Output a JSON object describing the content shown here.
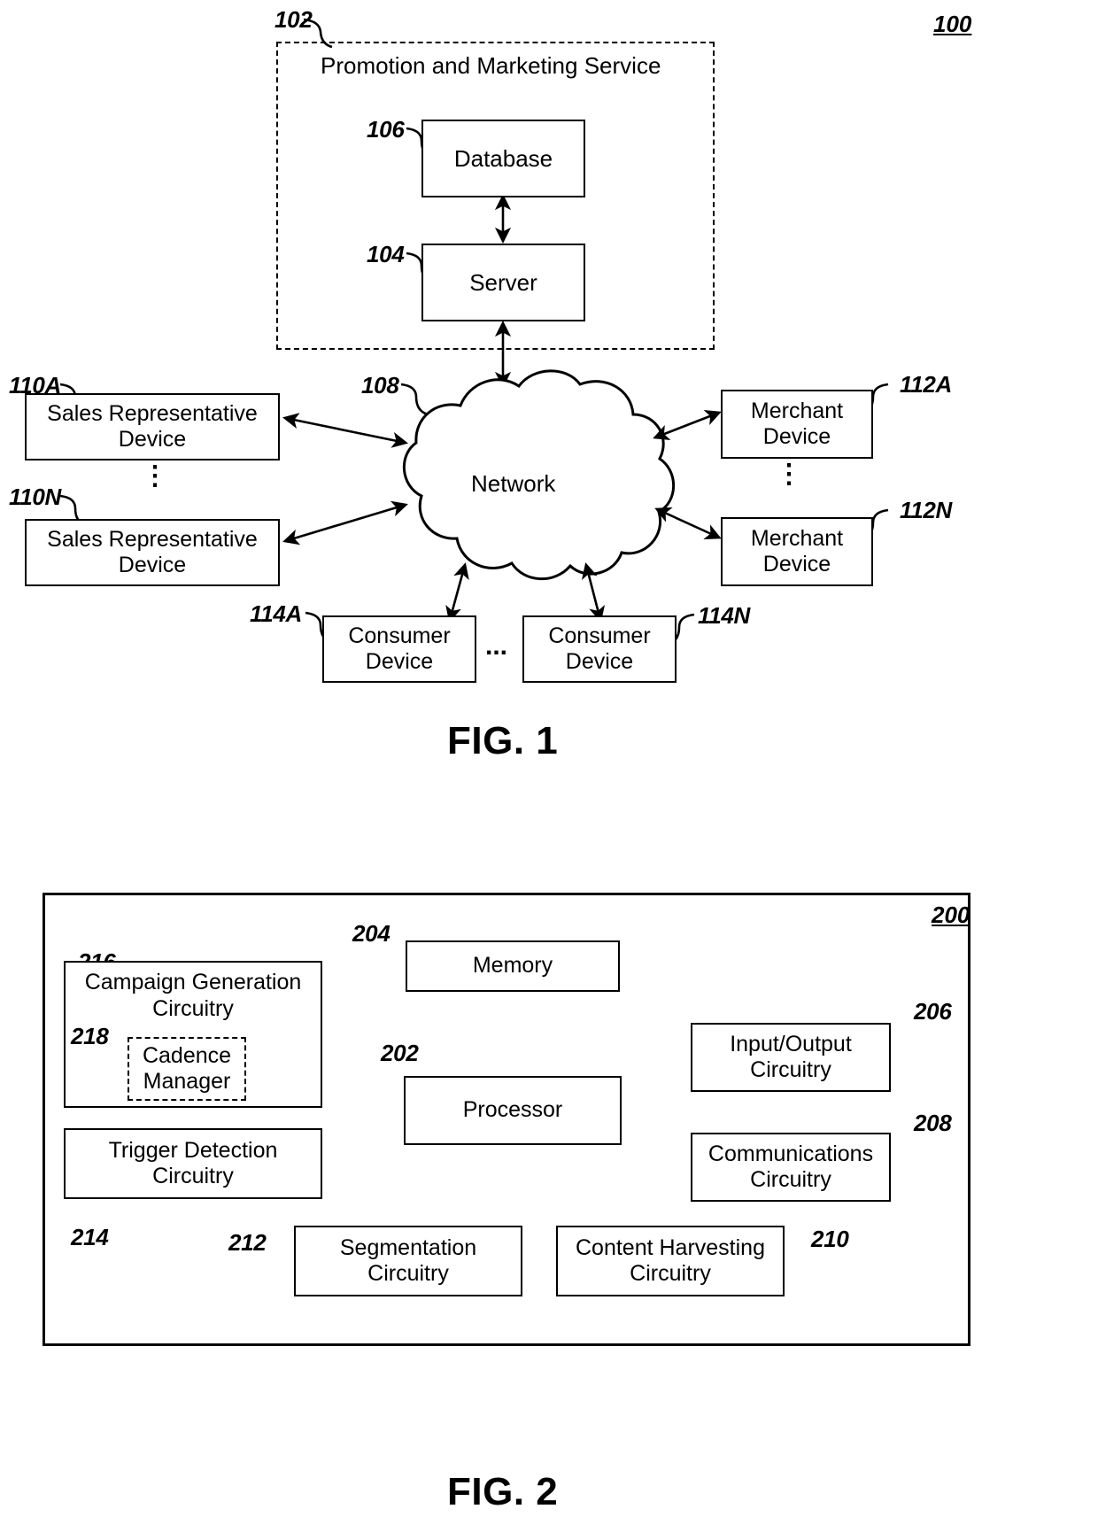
{
  "figure1": {
    "figure_label": "FIG. 1",
    "system_ref": "100",
    "service_container": {
      "ref": "102",
      "title": "Promotion and Marketing Service"
    },
    "database": {
      "ref": "106",
      "label": "Database"
    },
    "server": {
      "ref": "104",
      "label": "Server"
    },
    "network": {
      "ref": "108",
      "label": "Network"
    },
    "sales_rep_a": {
      "ref": "110A",
      "line1": "Sales Representative",
      "line2": "Device"
    },
    "sales_rep_n": {
      "ref": "110N",
      "line1": "Sales Representative",
      "line2": "Device"
    },
    "merchant_a": {
      "ref": "112A",
      "line1": "Merchant",
      "line2": "Device"
    },
    "merchant_n": {
      "ref": "112N",
      "line1": "Merchant",
      "line2": "Device"
    },
    "consumer_a": {
      "ref": "114A",
      "line1": "Consumer",
      "line2": "Device"
    },
    "consumer_n": {
      "ref": "114N",
      "line1": "Consumer",
      "line2": "Device"
    },
    "vertical_ellipsis": "⋮",
    "horizontal_ellipsis": "..."
  },
  "figure2": {
    "figure_label": "FIG. 2",
    "apparatus_ref": "200",
    "campaign_generation": {
      "ref": "216",
      "line1": "Campaign Generation",
      "line2": "Circuitry"
    },
    "cadence_manager": {
      "ref": "218",
      "line1": "Cadence",
      "line2": "Manager"
    },
    "trigger_detection": {
      "ref": "214",
      "line1": "Trigger Detection",
      "line2": "Circuitry"
    },
    "memory": {
      "ref": "204",
      "label": "Memory"
    },
    "processor": {
      "ref": "202",
      "label": "Processor"
    },
    "input_output": {
      "ref": "206",
      "line1": "Input/Output",
      "line2": "Circuitry"
    },
    "communications": {
      "ref": "208",
      "line1": "Communications",
      "line2": "Circuitry"
    },
    "segmentation": {
      "ref": "212",
      "line1": "Segmentation",
      "line2": "Circuitry"
    },
    "content_harvesting": {
      "ref": "210",
      "line1": "Content Harvesting",
      "line2": "Circuitry"
    }
  }
}
